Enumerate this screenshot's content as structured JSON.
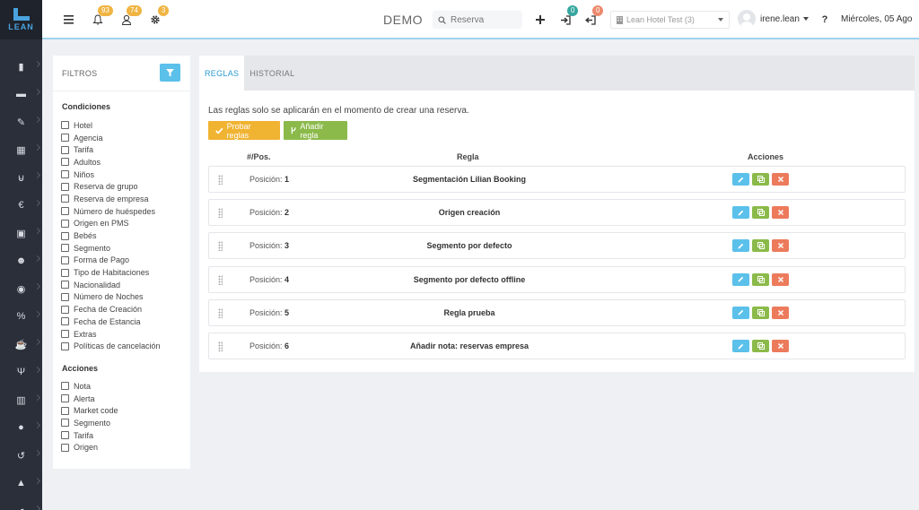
{
  "brand": {
    "logo_text": "LEAN"
  },
  "sidebar": {
    "icons": [
      "book-icon",
      "bed-icon",
      "wrench-icon",
      "calendar-icon",
      "cart-icon",
      "euro-icon",
      "money-icon",
      "users-icon",
      "globe-icon",
      "percent-icon",
      "coffee-icon",
      "cutlery-icon",
      "bar-chart-icon",
      "user-icon",
      "history-icon",
      "bell-icon",
      "share-icon"
    ]
  },
  "header": {
    "notifications_count": "93",
    "users_count": "74",
    "settings_count": "3",
    "title": "DEMO",
    "search_placeholder": "Reserva",
    "checkin_count": "0",
    "checkout_count": "0",
    "hotel_selected": "Lean Hotel Test (3)",
    "username": "irene.lean",
    "help": "?",
    "date": "Miércoles, 05 Ago"
  },
  "filters": {
    "title": "FILTROS",
    "conditions_title": "Condiciones",
    "conditions": [
      "Hotel",
      "Agencia",
      "Tarifa",
      "Adultos",
      "Niños",
      "Reserva de grupo",
      "Reserva de empresa",
      "Número de huéspedes",
      "Origen en PMS",
      "Bebés",
      "Segmento",
      "Forma de Pago",
      "Tipo de Habitaciones",
      "Nacionalidad",
      "Número de Noches",
      "Fecha de Creación",
      "Fecha de Estancia",
      "Extras",
      "Políticas de cancelación"
    ],
    "actions_title": "Acciones",
    "actions": [
      "Nota",
      "Alerta",
      "Market code",
      "Segmento",
      "Tarifa",
      "Origen"
    ]
  },
  "main": {
    "tabs": [
      {
        "label": "REGLAS",
        "active": true
      },
      {
        "label": "HISTORIAL",
        "active": false
      }
    ],
    "info_text": "Las reglas solo se aplicarán en el momento de crear una reserva.",
    "test_rules_label": "Probar reglas",
    "add_rule_label": "Añadir regla",
    "columns": {
      "pos": "#/Pos.",
      "rule": "Regla",
      "actions": "Acciones"
    },
    "position_prefix": "Posición:",
    "rows": [
      {
        "position": "1",
        "rule": "Segmentación Lilian Booking"
      },
      {
        "position": "2",
        "rule": "Origen creación"
      },
      {
        "position": "3",
        "rule": "Segmento por defecto"
      },
      {
        "position": "4",
        "rule": "Segmento por defecto offline"
      },
      {
        "position": "5",
        "rule": "Regla prueba"
      },
      {
        "position": "6",
        "rule": "Añadir nota: reservas empresa"
      }
    ]
  },
  "colors": {
    "accent": "#5bc0ea",
    "warning": "#f0b332",
    "success": "#8bba4a",
    "danger": "#ec7b5c",
    "sidebar": "#2b2f3a"
  }
}
